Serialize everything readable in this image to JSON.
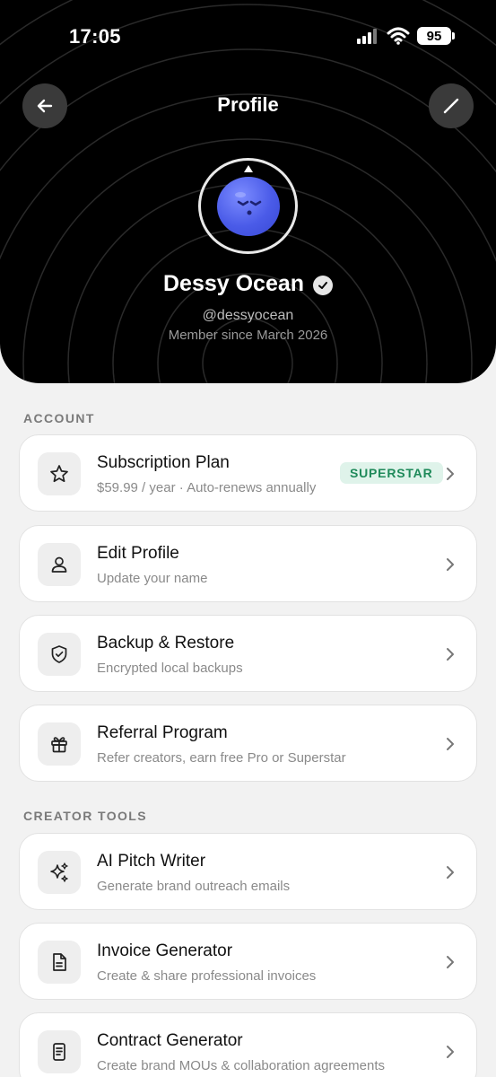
{
  "status_bar": {
    "time": "17:05",
    "battery": "95"
  },
  "header": {
    "title": "Profile"
  },
  "profile": {
    "name": "Dessy Ocean",
    "handle": "@dessyocean",
    "member_since": "Member since March 2026"
  },
  "sections": {
    "account": "ACCOUNT",
    "creator_tools": "CREATOR TOOLS"
  },
  "account_items": [
    {
      "title": "Subscription Plan",
      "subtitle": "$59.99 / year · Auto-renews annually",
      "badge": "SUPERSTAR",
      "icon": "star-icon"
    },
    {
      "title": "Edit Profile",
      "subtitle": "Update your name",
      "icon": "user-icon"
    },
    {
      "title": "Backup & Restore",
      "subtitle": "Encrypted local backups",
      "icon": "shield-check-icon"
    },
    {
      "title": "Referral Program",
      "subtitle": "Refer creators, earn free Pro or Superstar",
      "icon": "gift-icon"
    }
  ],
  "creator_items": [
    {
      "title": "AI Pitch Writer",
      "subtitle": "Generate brand outreach emails",
      "icon": "sparkles-icon"
    },
    {
      "title": "Invoice Generator",
      "subtitle": "Create & share professional invoices",
      "icon": "document-icon"
    },
    {
      "title": "Contract Generator",
      "subtitle": "Create brand MOUs & collaboration agreements",
      "icon": "contract-icon"
    }
  ],
  "colors": {
    "hero_bg": "#000000",
    "page_bg": "#f2f2f2",
    "badge_bg": "#dff3ea",
    "badge_text": "#1f8a5a",
    "avatar": "#4a5be8"
  }
}
